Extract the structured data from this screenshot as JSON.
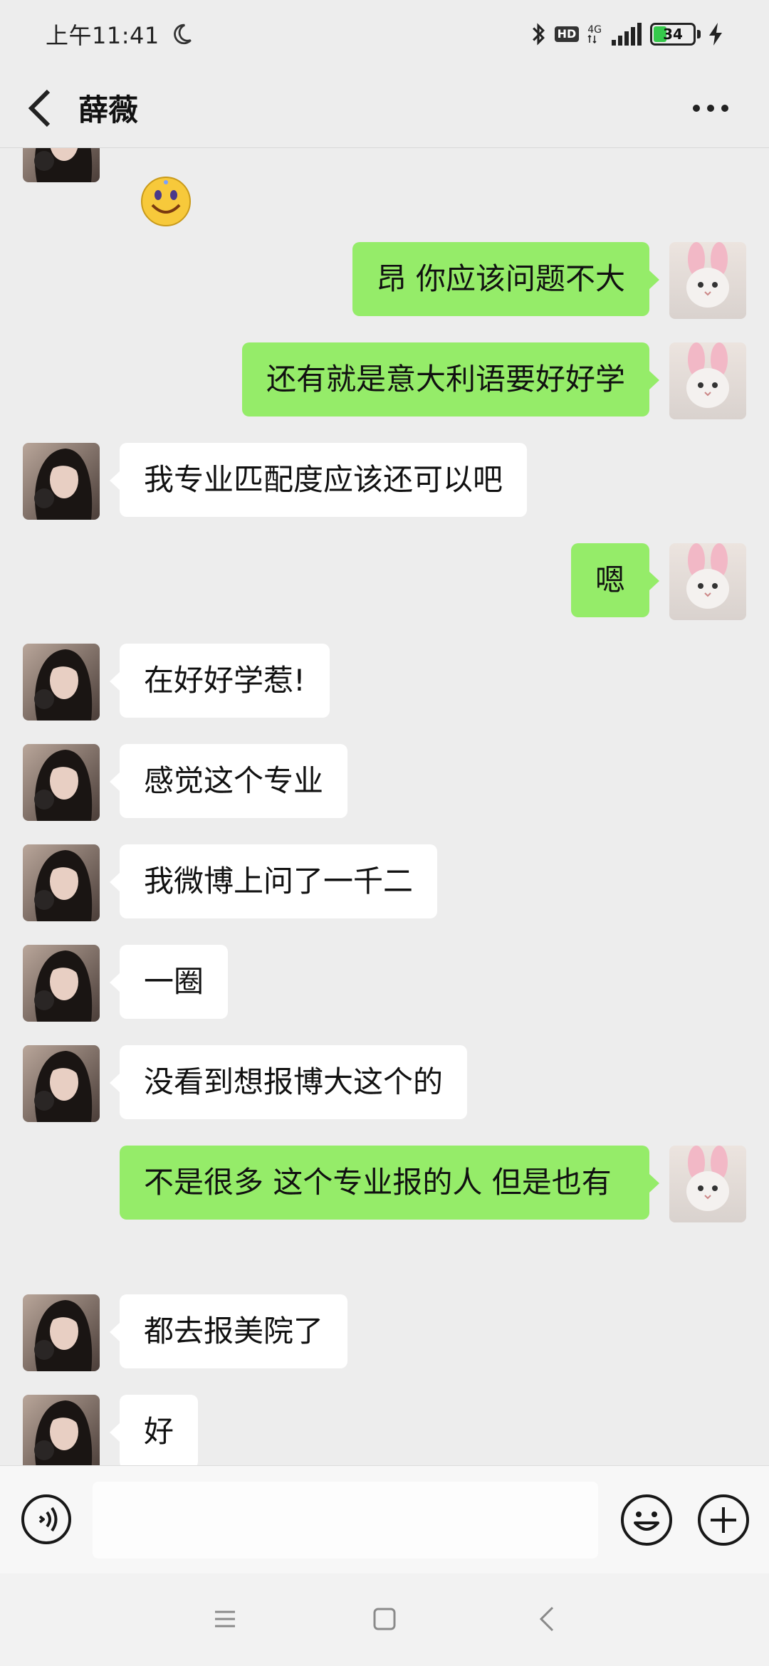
{
  "status_bar": {
    "time": "上午11:41",
    "hd": "HD",
    "network": "4G",
    "battery": "34",
    "battery_level": 0.34
  },
  "header": {
    "title": "薛薇"
  },
  "messages": [
    {
      "from": "them",
      "type": "emoji",
      "icon": "smiley-emoji"
    },
    {
      "from": "me",
      "text": "昂 你应该问题不大"
    },
    {
      "from": "me",
      "text": "还有就是意大利语要好好学"
    },
    {
      "from": "them",
      "text": "我专业匹配度应该还可以吧"
    },
    {
      "from": "me",
      "text": "嗯"
    },
    {
      "from": "them",
      "text": "在好好学惹!"
    },
    {
      "from": "them",
      "text": "感觉这个专业"
    },
    {
      "from": "them",
      "text": "我微博上问了一千二"
    },
    {
      "from": "them",
      "text": "一圈"
    },
    {
      "from": "them",
      "text": "没看到想报博大这个的"
    },
    {
      "from": "me",
      "text": "不是很多 这个专业报的人 但是也有"
    },
    {
      "from": "them",
      "text": "都去报美院了"
    },
    {
      "from": "them",
      "text": "好"
    }
  ],
  "input": {
    "value": "",
    "placeholder": ""
  },
  "colors": {
    "outgoing_bubble": "#95ec69",
    "incoming_bubble": "#ffffff",
    "background": "#ededed"
  }
}
